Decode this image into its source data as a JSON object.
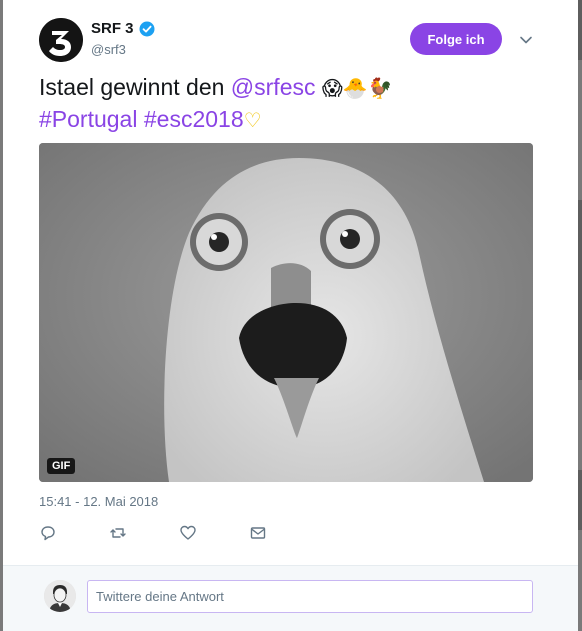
{
  "tweet": {
    "author": {
      "display_name": "SRF 3",
      "handle": "@srf3",
      "verified": true,
      "avatar_icon": "srf3-logo-icon"
    },
    "follow_label": "Folge ich",
    "text": {
      "plain": "Istael gewinnt den ",
      "mention": "@srfesc",
      "emojis": "😱🐣🐓",
      "hashtag_1": "#Portugal",
      "hashtag_2": "#esc2018",
      "heart": "♡"
    },
    "media": {
      "type": "gif",
      "badge": "GIF",
      "subject": "owl-gif"
    },
    "timestamp": "15:41 - 12. Mai 2018",
    "actions": [
      "reply-icon",
      "retweet-icon",
      "like-icon",
      "direct-message-icon"
    ]
  },
  "reply": {
    "placeholder": "Twittere deine Antwort"
  },
  "colors": {
    "accent": "#8a44e5",
    "link": "#8a44e5",
    "text": "#14171a",
    "muted": "#657786",
    "heart": "#f1c40f",
    "verified": "#1da1f2"
  }
}
